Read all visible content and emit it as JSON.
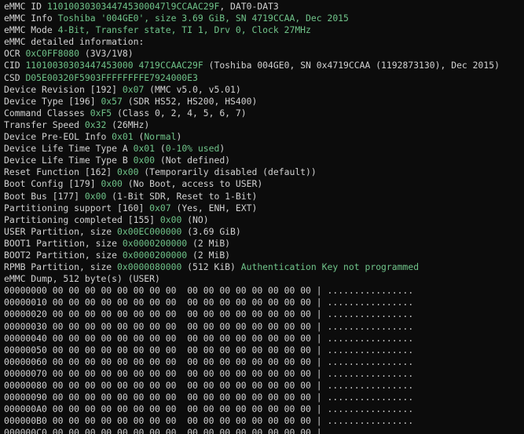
{
  "info_lines": [
    [
      {
        "t": "eMMC ID ",
        "c": "w"
      },
      {
        "t": "1101003030344745300047l9CCAAC29F",
        "c": "g"
      },
      {
        "t": ", DAT0-DAT3",
        "c": "w"
      }
    ],
    [
      {
        "t": "eMMC Info ",
        "c": "w"
      },
      {
        "t": "Toshiba '004GE0', size 3.69 GiB, SN 4719CCAA, Dec 2015",
        "c": "g"
      }
    ],
    [
      {
        "t": "eMMC Mode ",
        "c": "w"
      },
      {
        "t": "4-Bit, Transfer state, TI 1, Drv 0, Clock 27MHz",
        "c": "g"
      }
    ],
    [
      {
        "t": "eMMC detailed information:",
        "c": "w"
      }
    ],
    [
      {
        "t": "OCR ",
        "c": "w"
      },
      {
        "t": "0xC0FF8080",
        "c": "g"
      },
      {
        "t": " (3V3/1V8)",
        "c": "w"
      }
    ],
    [
      {
        "t": "CID ",
        "c": "w"
      },
      {
        "t": "11010030303447453000 4719CCAAC29F",
        "c": "g"
      },
      {
        "t": " (Toshiba 004GE0, SN 0x4719CCAA (1192873130), Dec 2015)",
        "c": "w"
      }
    ],
    [
      {
        "t": "CSD ",
        "c": "w"
      },
      {
        "t": "D05E00320F5903FFFFFFFFE7924000E3",
        "c": "g"
      }
    ],
    [
      {
        "t": "Device Revision [192] ",
        "c": "w"
      },
      {
        "t": "0x07",
        "c": "g"
      },
      {
        "t": " (MMC v5.0, v5.01)",
        "c": "w"
      }
    ],
    [
      {
        "t": "Device Type [196] ",
        "c": "w"
      },
      {
        "t": "0x57",
        "c": "g"
      },
      {
        "t": " (SDR HS52, HS200, HS400)",
        "c": "w"
      }
    ],
    [
      {
        "t": "Command Classes ",
        "c": "w"
      },
      {
        "t": "0xF5",
        "c": "g"
      },
      {
        "t": " (Class 0, 2, 4, 5, 6, 7)",
        "c": "w"
      }
    ],
    [
      {
        "t": "Transfer Speed ",
        "c": "w"
      },
      {
        "t": "0x32",
        "c": "g"
      },
      {
        "t": " (26MHz)",
        "c": "w"
      }
    ],
    [
      {
        "t": "Device Pre-EOL Info ",
        "c": "w"
      },
      {
        "t": "0x01",
        "c": "g"
      },
      {
        "t": " (",
        "c": "w"
      },
      {
        "t": "Normal",
        "c": "g"
      },
      {
        "t": ")",
        "c": "w"
      }
    ],
    [
      {
        "t": "Device Life Time Type A ",
        "c": "w"
      },
      {
        "t": "0x01",
        "c": "g"
      },
      {
        "t": " (",
        "c": "w"
      },
      {
        "t": "0-10% used",
        "c": "g"
      },
      {
        "t": ")",
        "c": "w"
      }
    ],
    [
      {
        "t": "Device Life Time Type B ",
        "c": "w"
      },
      {
        "t": "0x00",
        "c": "g"
      },
      {
        "t": " (Not defined)",
        "c": "w"
      }
    ],
    [
      {
        "t": "Reset Function [162] ",
        "c": "w"
      },
      {
        "t": "0x00",
        "c": "g"
      },
      {
        "t": " (Temporarily disabled (default))",
        "c": "w"
      }
    ],
    [
      {
        "t": "Boot Config [179] ",
        "c": "w"
      },
      {
        "t": "0x00",
        "c": "g"
      },
      {
        "t": " (No Boot, access to USER)",
        "c": "w"
      }
    ],
    [
      {
        "t": "Boot Bus [177] ",
        "c": "w"
      },
      {
        "t": "0x00",
        "c": "g"
      },
      {
        "t": " (1-Bit SDR, Reset to 1-Bit)",
        "c": "w"
      }
    ],
    [
      {
        "t": "Partitioning support [160] ",
        "c": "w"
      },
      {
        "t": "0x07",
        "c": "g"
      },
      {
        "t": " (Yes, ENH, EXT)",
        "c": "w"
      }
    ],
    [
      {
        "t": "Partitioning completed [155] ",
        "c": "w"
      },
      {
        "t": "0x00",
        "c": "g"
      },
      {
        "t": " (NO)",
        "c": "w"
      }
    ],
    [
      {
        "t": "USER Partition, size ",
        "c": "w"
      },
      {
        "t": "0x00EC000000",
        "c": "g"
      },
      {
        "t": " (3.69 GiB)",
        "c": "w"
      }
    ],
    [
      {
        "t": "BOOT1 Partition, size ",
        "c": "w"
      },
      {
        "t": "0x0000200000",
        "c": "g"
      },
      {
        "t": " (2 MiB)",
        "c": "w"
      }
    ],
    [
      {
        "t": "BOOT2 Partition, size ",
        "c": "w"
      },
      {
        "t": "0x0000200000",
        "c": "g"
      },
      {
        "t": " (2 MiB)",
        "c": "w"
      }
    ],
    [
      {
        "t": "RPMB Partition, size ",
        "c": "w"
      },
      {
        "t": "0x0000080000",
        "c": "g"
      },
      {
        "t": " (512 KiB) ",
        "c": "w"
      },
      {
        "t": "Authentication Key not programmed",
        "c": "g"
      }
    ],
    [
      {
        "t": "eMMC Dump, 512 byte(s) (USER)",
        "c": "w"
      }
    ]
  ],
  "dump": {
    "offsets": [
      "00000000",
      "00000010",
      "00000020",
      "00000030",
      "00000040",
      "00000050",
      "00000060",
      "00000070",
      "00000080",
      "00000090",
      "000000A0",
      "000000B0",
      "000000C0"
    ],
    "bytes_left": "00 00 00 00 00 00 00 00",
    "bytes_right": "00 00 00 00 00 00 00 00",
    "separator": "|",
    "ascii": "................"
  }
}
